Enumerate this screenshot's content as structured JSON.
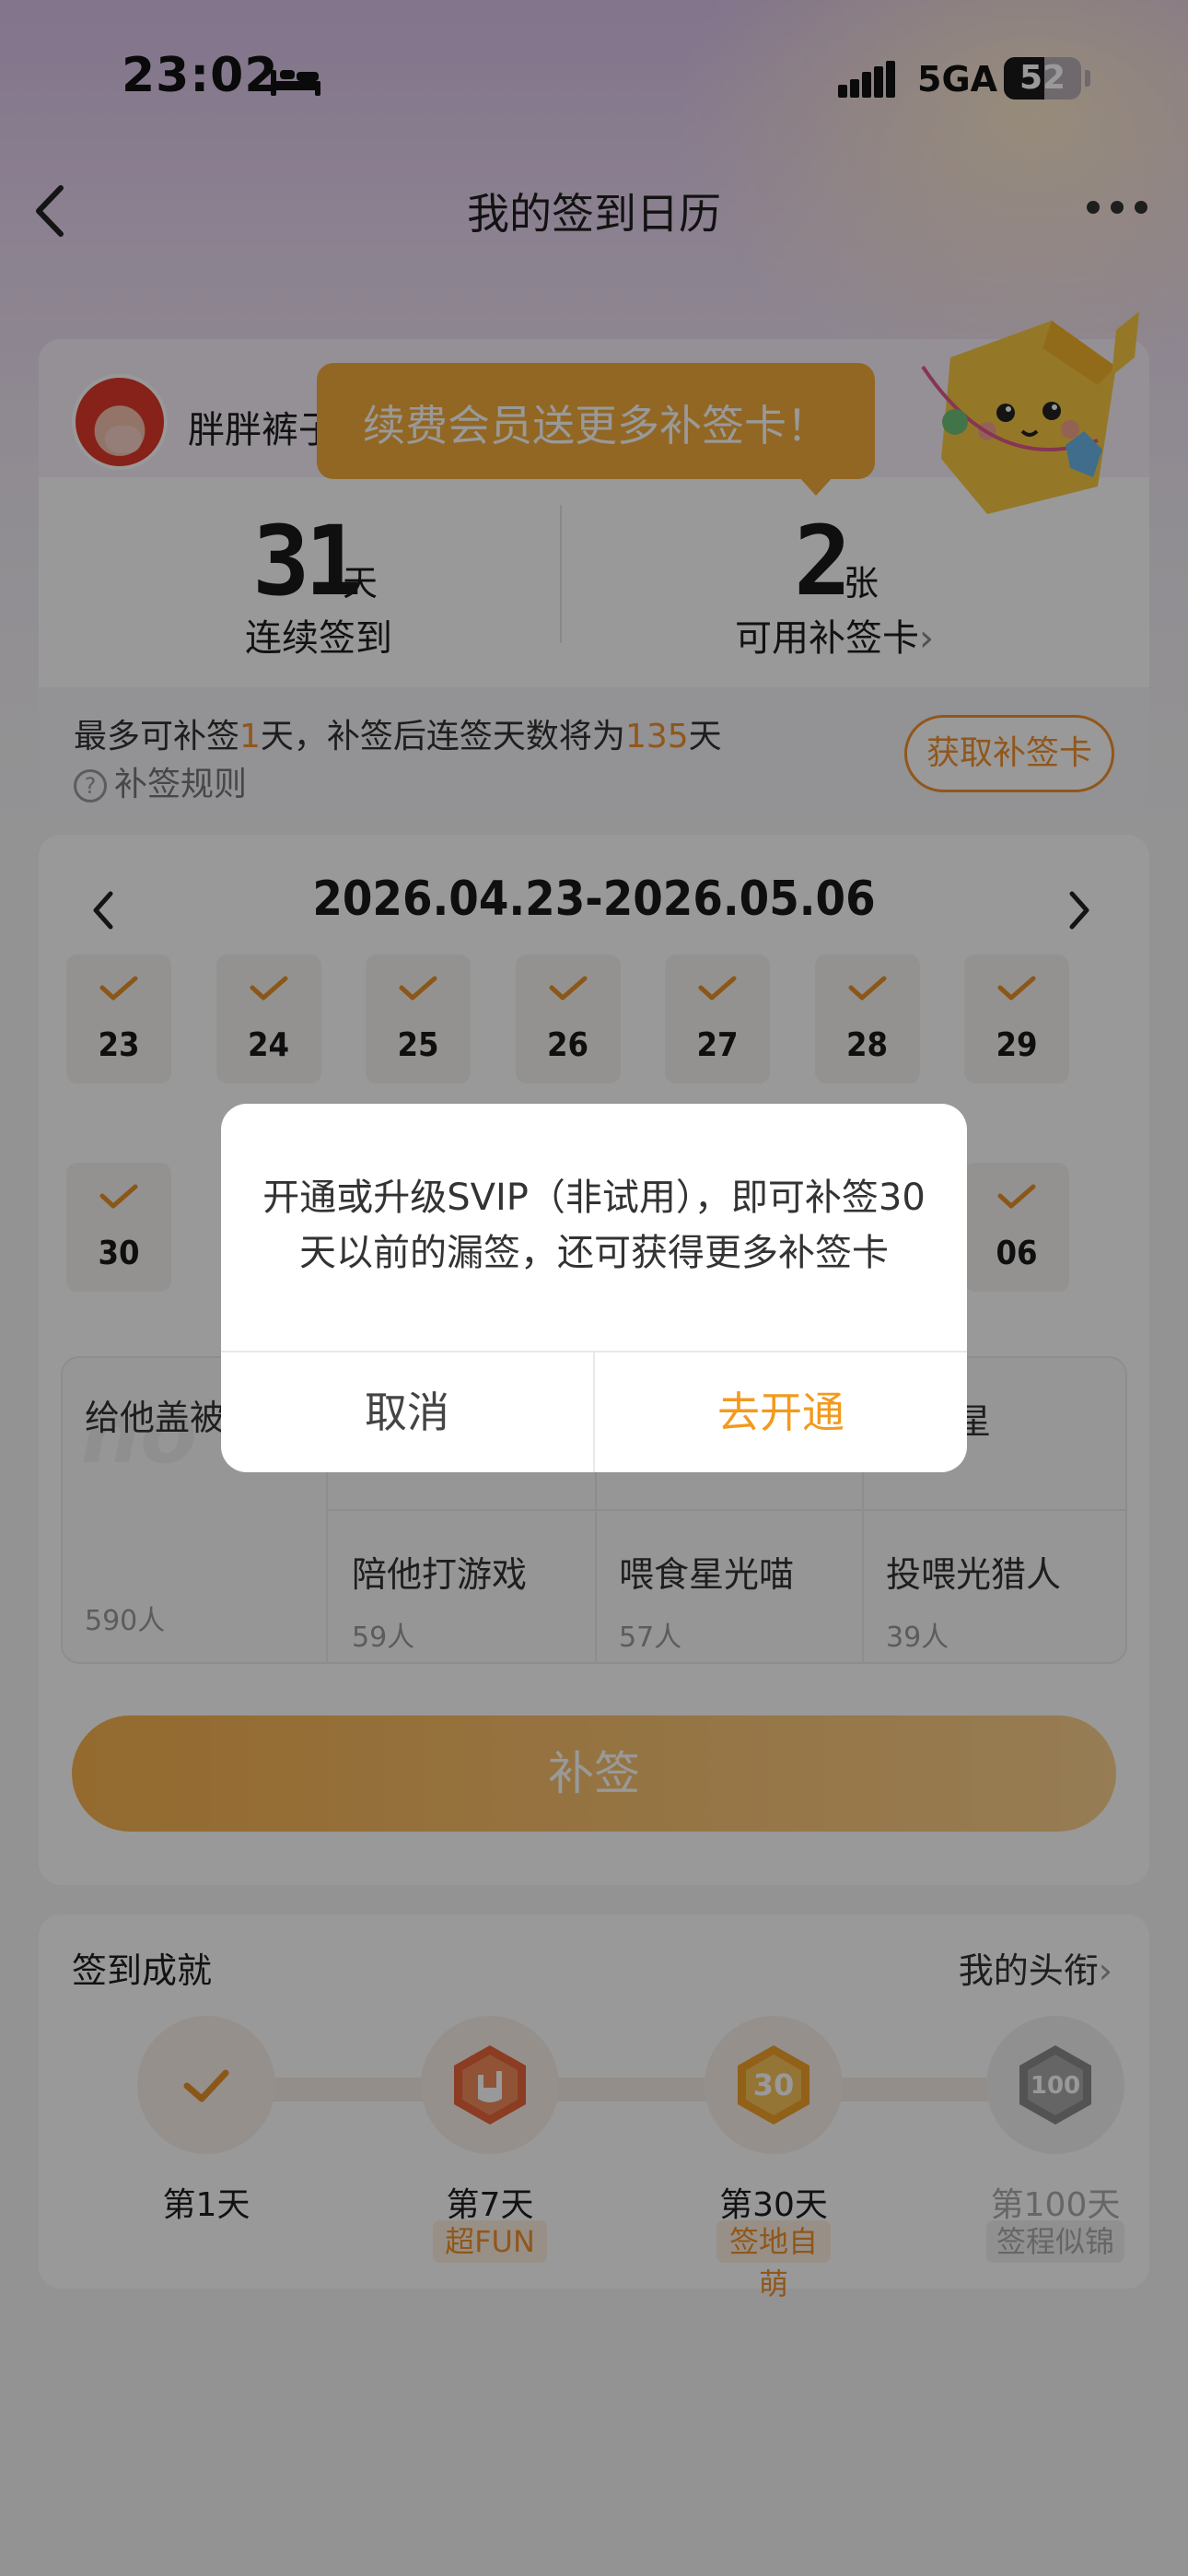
{
  "status_bar": {
    "time": "23:02",
    "network": "5GA",
    "battery": "52",
    "battery_level": 0.52
  },
  "nav": {
    "title": "我的签到日历"
  },
  "profile": {
    "username": "胖胖裤子",
    "tooltip": "续费会员送更多补签卡！"
  },
  "stats": {
    "streak_value": "31",
    "streak_unit": "天",
    "streak_label": "连续签到",
    "cards_value": "2",
    "cards_unit": "张",
    "cards_label": "可用补签卡",
    "cards_chevron": "›"
  },
  "makeup": {
    "prefix": "最多可补签",
    "days": "1",
    "middle": "天，补签后连签天数将为",
    "total": "135",
    "suffix": "天",
    "rules_label": "补签规则",
    "get_card_button": "获取补签卡"
  },
  "calendar": {
    "range": "2026.04.23-2026.05.06",
    "days_row1": [
      {
        "day": "23",
        "checked": true
      },
      {
        "day": "24",
        "checked": true
      },
      {
        "day": "25",
        "checked": true
      },
      {
        "day": "26",
        "checked": true
      },
      {
        "day": "27",
        "checked": true
      },
      {
        "day": "28",
        "checked": true
      },
      {
        "day": "29",
        "checked": true
      }
    ],
    "days_row2_visible": [
      {
        "day": "30",
        "checked": true
      },
      {
        "day": "06",
        "checked": true
      }
    ]
  },
  "options": {
    "big": {
      "title": "给他盖被",
      "count": "590人"
    },
    "top_right": {
      "title": "看星星"
    },
    "cells": [
      {
        "title": "陪他打游戏",
        "count": "59人"
      },
      {
        "title": "喂食星光喵",
        "count": "57人"
      },
      {
        "title": "投喂光猎人",
        "count": "39人"
      }
    ]
  },
  "makeup_button": "补签",
  "achievements": {
    "title": "签到成就",
    "link": "我的头衔",
    "link_chevron": "›",
    "items": [
      {
        "day": "第1天",
        "tag": "",
        "locked": false
      },
      {
        "day": "第7天",
        "tag": "超FUN",
        "locked": false
      },
      {
        "day": "第30天",
        "tag": "签地自萌",
        "locked": false
      },
      {
        "day": "第100天",
        "tag": "签程似锦",
        "locked": true
      }
    ]
  },
  "dialog": {
    "message": "开通或升级SVIP（非试用），即可补签30天以前的漏签，还可获得更多补签卡",
    "cancel": "取消",
    "confirm": "去开通"
  },
  "colors": {
    "accent": "#f29a1e",
    "check": "#e8912a",
    "tooltip": "#f4ac3b"
  }
}
